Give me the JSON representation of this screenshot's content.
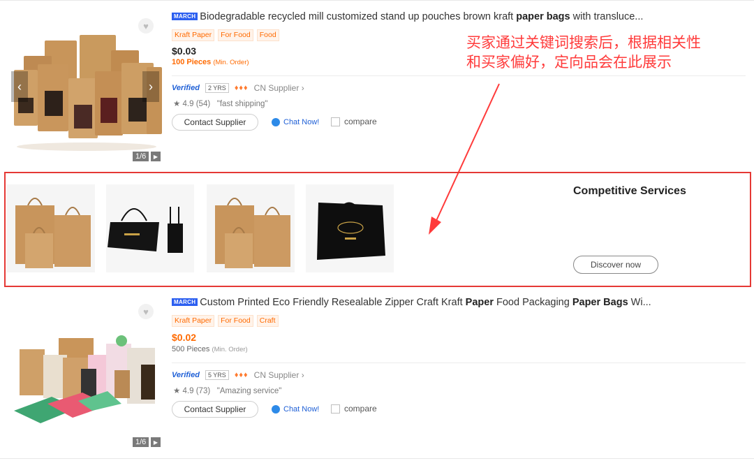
{
  "annotation": {
    "line1": "买家通过关键词搜索后，根据相关性",
    "line2": "和买家偏好，定向品会在此展示"
  },
  "products": [
    {
      "badge": "MARCH",
      "title_pre": "Biodegradable recycled mill customized stand up pouches brown kraft ",
      "title_bold1": "paper bags",
      "title_mid": " with transluce...",
      "title_bold2": "",
      "title_post": "",
      "tags": [
        "Kraft Paper",
        "For Food",
        "Food"
      ],
      "price": "$0.03",
      "moq_qty": "100 Pieces",
      "moq_label": "(Min. Order)",
      "verified": "Verified",
      "years": "2 YRS",
      "supplier": "CN Supplier",
      "rating": "4.9",
      "reviews": "(54)",
      "review_quote": "\"fast shipping\"",
      "contact_label": "Contact Supplier",
      "chat_label": "Chat Now!",
      "compare_label": "compare",
      "image_counter": "1/6"
    },
    {
      "badge": "MARCH",
      "title_pre": "Custom Printed Eco Friendly Resealable Zipper Craft Kraft ",
      "title_bold1": "Paper",
      "title_mid": " Food Packaging ",
      "title_bold2": "Paper Bags",
      "title_post": " Wi...",
      "tags": [
        "Kraft Paper",
        "For Food",
        "Craft"
      ],
      "price": "$0.02",
      "moq_qty": "500 Pieces",
      "moq_label": "(Min. Order)",
      "verified": "Verified",
      "years": "5 YRS",
      "supplier": "CN Supplier",
      "rating": "4.9",
      "reviews": "(73)",
      "review_quote": "\"Amazing service\"",
      "contact_label": "Contact Supplier",
      "chat_label": "Chat Now!",
      "compare_label": "compare",
      "image_counter": "1/6"
    }
  ],
  "promo": {
    "title": "Competitive Services",
    "button": "Discover now"
  },
  "colors": {
    "accent_orange": "#ff6a00",
    "annotation_red": "#ff3b3b",
    "frame_red": "#e53935",
    "verified_blue": "#1e5fd6"
  }
}
